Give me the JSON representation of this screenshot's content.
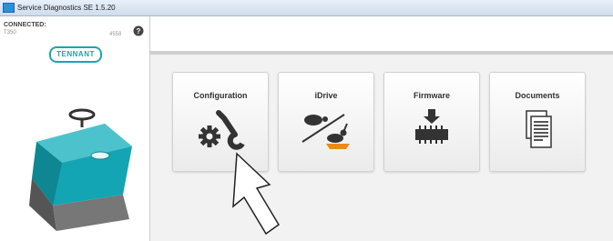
{
  "window": {
    "title": "Service Diagnostics SE 1.5.20"
  },
  "sidebar": {
    "connection_label": "CONNECTED:",
    "model": "T350",
    "serial": "4558",
    "logo_text": "TENNANT",
    "help_icon": "help-icon"
  },
  "tiles": [
    {
      "label": "Configuration",
      "icon": "wrench-gear-icon"
    },
    {
      "label": "iDrive",
      "icon": "turtle-rabbit-icon"
    },
    {
      "label": "Firmware",
      "icon": "firmware-chip-icon"
    },
    {
      "label": "Documents",
      "icon": "documents-icon"
    }
  ],
  "colors": {
    "brand": "#1aa6b0",
    "icon_dark": "#333333",
    "content_bg": "#f2f2f2"
  }
}
